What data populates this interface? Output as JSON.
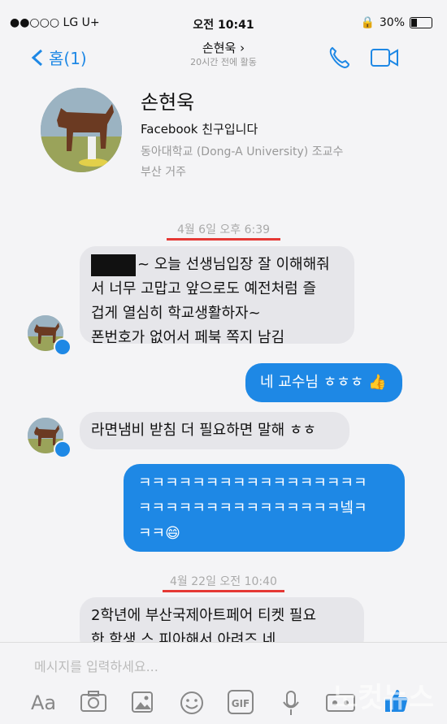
{
  "status": {
    "carrier": "●●○○○ LG U+",
    "time": "오전 10:41",
    "battery": "30%",
    "battery_level": 0.3
  },
  "nav": {
    "back_label": "홈(1)",
    "title": "손현욱 ›",
    "subtitle": "20시간 전에 활동"
  },
  "profile": {
    "name": "손현욱",
    "friend": "Facebook 친구입니다",
    "school": "동아대학교 (Dong-A University) 조교수",
    "location": "부산 거주"
  },
  "messages": {
    "ts1": "4월 6일 오후 6:39",
    "m1": [
      "~ 오늘 선생님입장 잘 이해해줘",
      "서 너무 고맙고 앞으로도 예전처럼 즐",
      "겁게 열심히 학교생활하자~",
      "폰번호가 없어서 페북 쪽지 남김"
    ],
    "r1": "네 교수님 ㅎㅎㅎ",
    "m2": "라면냄비 받침 더 필요하면 말해 ㅎㅎ",
    "r2": [
      "ㅋㅋㅋㅋㅋㅋㅋㅋㅋㅋㅋㅋㅋㅋㅋㅋㅋ",
      "ㅋㅋㅋㅋㅋㅋㅋㅋㅋㅋㅋㅋㅋㅋㅋ넼ㅋ",
      "ㅋㅋ"
    ],
    "ts2": "4월 22일 오전 10:40",
    "m3": [
      "2학년에 부산국제아트페어 티켓 필요",
      "한 학생 스 피아해서 아려즈 네"
    ]
  },
  "composer": {
    "placeholder": "메시지를 입력하세요...",
    "aa": "Aa",
    "gif": "GIF"
  },
  "watermark": "노컷뉴스",
  "colors": {
    "accent": "#1e88e5",
    "underline": "#e53935"
  }
}
